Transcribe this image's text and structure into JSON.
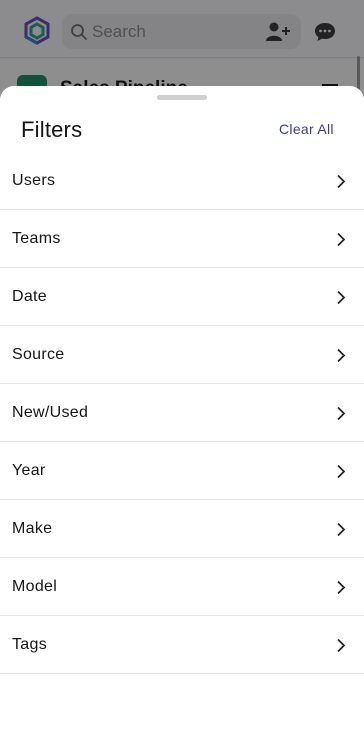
{
  "header": {
    "search_placeholder": "Search",
    "logo_icon": "app-logo-icon",
    "add_user_icon": "add-user-icon",
    "chat_icon": "chat-icon"
  },
  "background": {
    "page_title": "Sales Pipeline"
  },
  "filters_sheet": {
    "title": "Filters",
    "clear_all_label": "Clear All",
    "items": [
      {
        "label": "Users"
      },
      {
        "label": "Teams"
      },
      {
        "label": "Date"
      },
      {
        "label": "Source"
      },
      {
        "label": "New/Used"
      },
      {
        "label": "Year"
      },
      {
        "label": "Make"
      },
      {
        "label": "Model"
      },
      {
        "label": "Tags"
      }
    ]
  },
  "colors": {
    "accent": "#3b3f8c",
    "badge_green": "#1e8f64",
    "divider": "#e6e6e8"
  }
}
